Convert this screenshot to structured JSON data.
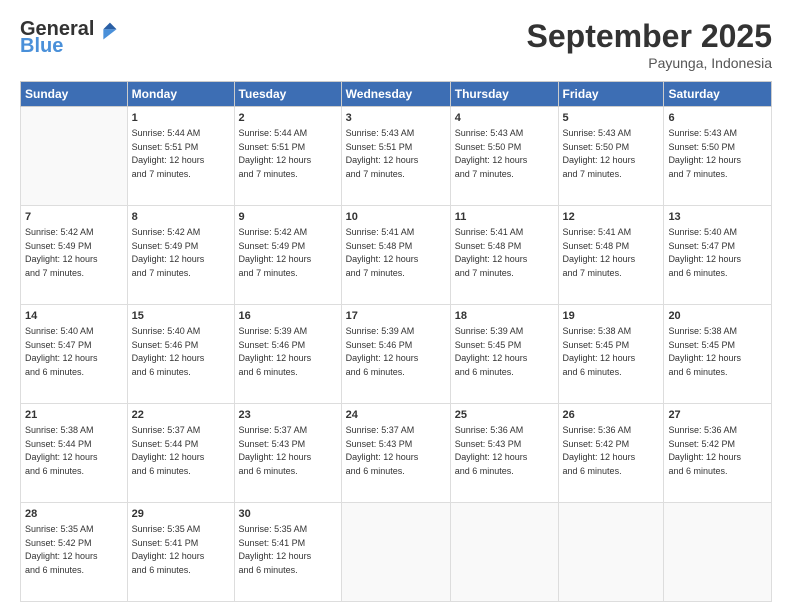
{
  "header": {
    "logo": {
      "general": "General",
      "blue": "Blue"
    },
    "title": "September 2025",
    "subtitle": "Payunga, Indonesia"
  },
  "weekdays": [
    "Sunday",
    "Monday",
    "Tuesday",
    "Wednesday",
    "Thursday",
    "Friday",
    "Saturday"
  ],
  "weeks": [
    [
      {
        "day": "",
        "info": ""
      },
      {
        "day": "1",
        "info": "Sunrise: 5:44 AM\nSunset: 5:51 PM\nDaylight: 12 hours\nand 7 minutes."
      },
      {
        "day": "2",
        "info": "Sunrise: 5:44 AM\nSunset: 5:51 PM\nDaylight: 12 hours\nand 7 minutes."
      },
      {
        "day": "3",
        "info": "Sunrise: 5:43 AM\nSunset: 5:51 PM\nDaylight: 12 hours\nand 7 minutes."
      },
      {
        "day": "4",
        "info": "Sunrise: 5:43 AM\nSunset: 5:50 PM\nDaylight: 12 hours\nand 7 minutes."
      },
      {
        "day": "5",
        "info": "Sunrise: 5:43 AM\nSunset: 5:50 PM\nDaylight: 12 hours\nand 7 minutes."
      },
      {
        "day": "6",
        "info": "Sunrise: 5:43 AM\nSunset: 5:50 PM\nDaylight: 12 hours\nand 7 minutes."
      }
    ],
    [
      {
        "day": "7",
        "info": "Sunrise: 5:42 AM\nSunset: 5:49 PM\nDaylight: 12 hours\nand 7 minutes."
      },
      {
        "day": "8",
        "info": "Sunrise: 5:42 AM\nSunset: 5:49 PM\nDaylight: 12 hours\nand 7 minutes."
      },
      {
        "day": "9",
        "info": "Sunrise: 5:42 AM\nSunset: 5:49 PM\nDaylight: 12 hours\nand 7 minutes."
      },
      {
        "day": "10",
        "info": "Sunrise: 5:41 AM\nSunset: 5:48 PM\nDaylight: 12 hours\nand 7 minutes."
      },
      {
        "day": "11",
        "info": "Sunrise: 5:41 AM\nSunset: 5:48 PM\nDaylight: 12 hours\nand 7 minutes."
      },
      {
        "day": "12",
        "info": "Sunrise: 5:41 AM\nSunset: 5:48 PM\nDaylight: 12 hours\nand 7 minutes."
      },
      {
        "day": "13",
        "info": "Sunrise: 5:40 AM\nSunset: 5:47 PM\nDaylight: 12 hours\nand 6 minutes."
      }
    ],
    [
      {
        "day": "14",
        "info": "Sunrise: 5:40 AM\nSunset: 5:47 PM\nDaylight: 12 hours\nand 6 minutes."
      },
      {
        "day": "15",
        "info": "Sunrise: 5:40 AM\nSunset: 5:46 PM\nDaylight: 12 hours\nand 6 minutes."
      },
      {
        "day": "16",
        "info": "Sunrise: 5:39 AM\nSunset: 5:46 PM\nDaylight: 12 hours\nand 6 minutes."
      },
      {
        "day": "17",
        "info": "Sunrise: 5:39 AM\nSunset: 5:46 PM\nDaylight: 12 hours\nand 6 minutes."
      },
      {
        "day": "18",
        "info": "Sunrise: 5:39 AM\nSunset: 5:45 PM\nDaylight: 12 hours\nand 6 minutes."
      },
      {
        "day": "19",
        "info": "Sunrise: 5:38 AM\nSunset: 5:45 PM\nDaylight: 12 hours\nand 6 minutes."
      },
      {
        "day": "20",
        "info": "Sunrise: 5:38 AM\nSunset: 5:45 PM\nDaylight: 12 hours\nand 6 minutes."
      }
    ],
    [
      {
        "day": "21",
        "info": "Sunrise: 5:38 AM\nSunset: 5:44 PM\nDaylight: 12 hours\nand 6 minutes."
      },
      {
        "day": "22",
        "info": "Sunrise: 5:37 AM\nSunset: 5:44 PM\nDaylight: 12 hours\nand 6 minutes."
      },
      {
        "day": "23",
        "info": "Sunrise: 5:37 AM\nSunset: 5:43 PM\nDaylight: 12 hours\nand 6 minutes."
      },
      {
        "day": "24",
        "info": "Sunrise: 5:37 AM\nSunset: 5:43 PM\nDaylight: 12 hours\nand 6 minutes."
      },
      {
        "day": "25",
        "info": "Sunrise: 5:36 AM\nSunset: 5:43 PM\nDaylight: 12 hours\nand 6 minutes."
      },
      {
        "day": "26",
        "info": "Sunrise: 5:36 AM\nSunset: 5:42 PM\nDaylight: 12 hours\nand 6 minutes."
      },
      {
        "day": "27",
        "info": "Sunrise: 5:36 AM\nSunset: 5:42 PM\nDaylight: 12 hours\nand 6 minutes."
      }
    ],
    [
      {
        "day": "28",
        "info": "Sunrise: 5:35 AM\nSunset: 5:42 PM\nDaylight: 12 hours\nand 6 minutes."
      },
      {
        "day": "29",
        "info": "Sunrise: 5:35 AM\nSunset: 5:41 PM\nDaylight: 12 hours\nand 6 minutes."
      },
      {
        "day": "30",
        "info": "Sunrise: 5:35 AM\nSunset: 5:41 PM\nDaylight: 12 hours\nand 6 minutes."
      },
      {
        "day": "",
        "info": ""
      },
      {
        "day": "",
        "info": ""
      },
      {
        "day": "",
        "info": ""
      },
      {
        "day": "",
        "info": ""
      }
    ]
  ]
}
